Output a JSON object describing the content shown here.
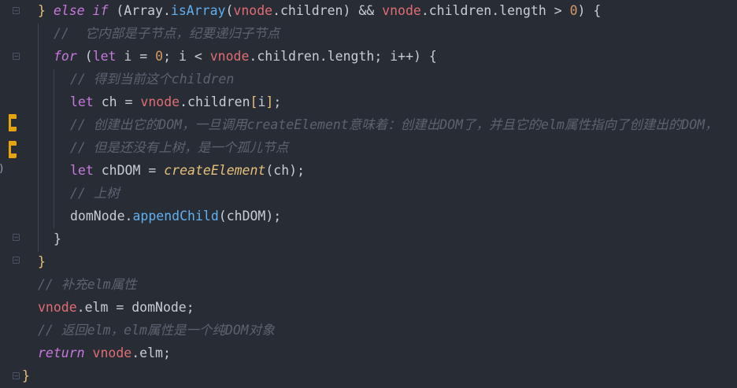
{
  "editor": {
    "lines": [
      {
        "indent": 48,
        "tokens": [
          {
            "t": "} ",
            "c": "br"
          },
          {
            "t": "else if",
            "c": "kw"
          },
          {
            "t": " (Array.",
            "c": "tx"
          },
          {
            "t": "isArray",
            "c": "fn"
          },
          {
            "t": "(",
            "c": "tx"
          },
          {
            "t": "vnode",
            "c": "id"
          },
          {
            "t": ".children) && ",
            "c": "tx"
          },
          {
            "t": "vnode",
            "c": "id"
          },
          {
            "t": ".children.length > ",
            "c": "tx"
          },
          {
            "t": "0",
            "c": "num"
          },
          {
            "t": ") {",
            "c": "tx"
          }
        ]
      },
      {
        "indent": 68,
        "tokens": [
          {
            "t": "//  它内部是子节点，纪要递归子节点",
            "c": "cm"
          }
        ]
      },
      {
        "indent": 68,
        "tokens": [
          {
            "t": "for",
            "c": "kw"
          },
          {
            "t": " (",
            "c": "tx"
          },
          {
            "t": "let",
            "c": "kwn"
          },
          {
            "t": " i = ",
            "c": "tx"
          },
          {
            "t": "0",
            "c": "num"
          },
          {
            "t": "; i < ",
            "c": "tx"
          },
          {
            "t": "vnode",
            "c": "id"
          },
          {
            "t": ".children.length; i++) {",
            "c": "tx"
          }
        ]
      },
      {
        "indent": 89,
        "tokens": [
          {
            "t": "// 得到当前这个children",
            "c": "cm"
          }
        ]
      },
      {
        "indent": 89,
        "tokens": [
          {
            "t": "let",
            "c": "kwn"
          },
          {
            "t": " ch = ",
            "c": "tx"
          },
          {
            "t": "vnode",
            "c": "id"
          },
          {
            "t": ".children",
            "c": "tx"
          },
          {
            "t": "[",
            "c": "br"
          },
          {
            "t": "i",
            "c": "tx"
          },
          {
            "t": "]",
            "c": "br"
          },
          {
            "t": ";",
            "c": "tx"
          }
        ]
      },
      {
        "indent": 89,
        "tokens": [
          {
            "t": "// 创建出它的DOM，一旦调用createElement意味着：创建出DOM了，并且它的elm属性指向了创建出的DOM，",
            "c": "cm"
          }
        ]
      },
      {
        "indent": 89,
        "tokens": [
          {
            "t": "// 但是还没有上树，是一个孤儿节点",
            "c": "cm"
          }
        ]
      },
      {
        "indent": 89,
        "tokens": [
          {
            "t": "let",
            "c": "kwn"
          },
          {
            "t": " chDOM = ",
            "c": "tx"
          },
          {
            "t": "createElement",
            "c": "fni"
          },
          {
            "t": "(ch);",
            "c": "tx"
          }
        ]
      },
      {
        "indent": 89,
        "tokens": [
          {
            "t": "// 上树",
            "c": "cm"
          }
        ]
      },
      {
        "indent": 89,
        "tokens": [
          {
            "t": "domNode.",
            "c": "tx"
          },
          {
            "t": "appendChild",
            "c": "fn"
          },
          {
            "t": "(chDOM);",
            "c": "tx"
          }
        ]
      },
      {
        "indent": 68,
        "tokens": [
          {
            "t": "}",
            "c": "tx"
          }
        ]
      },
      {
        "indent": 48,
        "tokens": [
          {
            "t": "}",
            "c": "br"
          }
        ]
      },
      {
        "indent": 48,
        "tokens": [
          {
            "t": "// 补充elm属性",
            "c": "cm"
          }
        ]
      },
      {
        "indent": 48,
        "tokens": [
          {
            "t": "vnode",
            "c": "id"
          },
          {
            "t": ".elm = domNode;",
            "c": "tx"
          }
        ]
      },
      {
        "indent": 48,
        "tokens": [
          {
            "t": "// 返回elm，elm属性是一个纯DOM对象",
            "c": "cm"
          }
        ]
      },
      {
        "indent": 48,
        "tokens": [
          {
            "t": "return",
            "c": "kw"
          },
          {
            "t": " ",
            "c": "tx"
          },
          {
            "t": "vnode",
            "c": "id"
          },
          {
            "t": ".elm;",
            "c": "tx"
          }
        ]
      },
      {
        "indent": 28,
        "tokens": [
          {
            "t": "}",
            "c": "br"
          }
        ]
      }
    ]
  }
}
